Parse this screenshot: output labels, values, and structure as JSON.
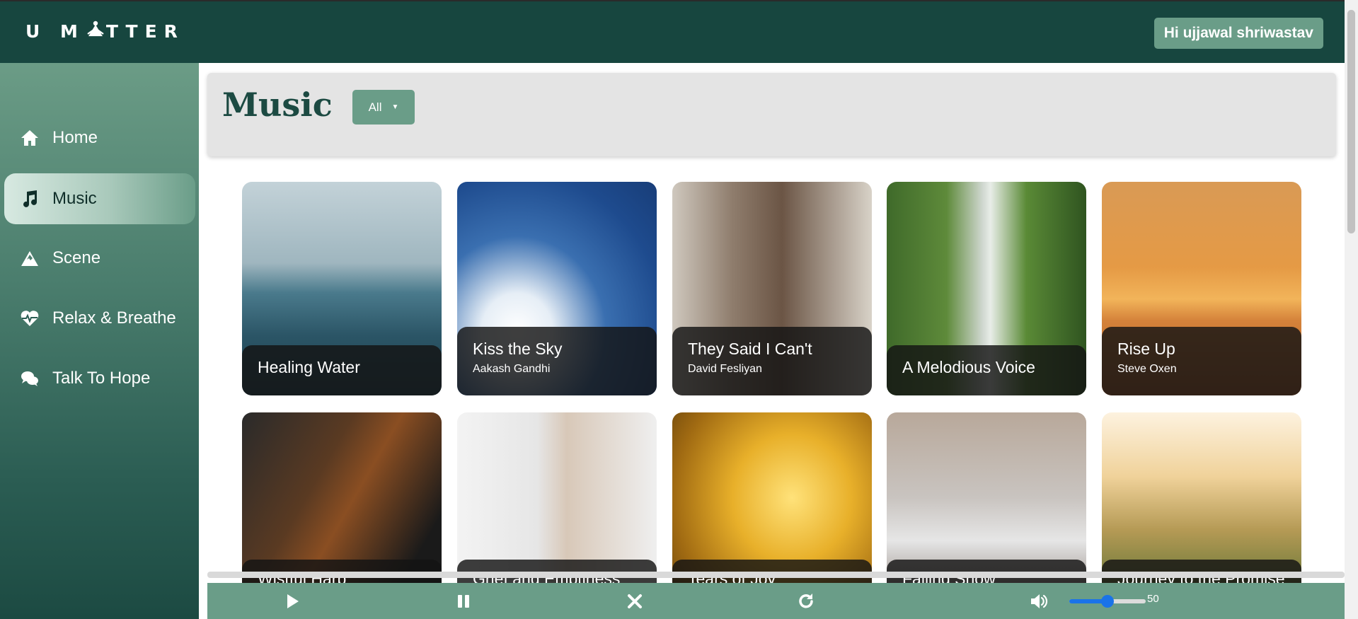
{
  "header": {
    "logo_left": "U M",
    "logo_right": "TTER",
    "greeting": "Hi ujjawal shriwastav"
  },
  "sidebar": {
    "items": [
      {
        "label": "Home",
        "icon": "home-icon",
        "active": false
      },
      {
        "label": "Music",
        "icon": "music-note-icon",
        "active": true
      },
      {
        "label": "Scene",
        "icon": "mountain-icon",
        "active": false
      },
      {
        "label": "Relax & Breathe",
        "icon": "heartbeat-icon",
        "active": false
      },
      {
        "label": "Talk To Hope",
        "icon": "chat-bubbles-icon",
        "active": false
      }
    ]
  },
  "main": {
    "title": "Music",
    "filter": {
      "selected": "All"
    },
    "cards": [
      {
        "title": "Healing Water",
        "artist": ""
      },
      {
        "title": "Kiss the Sky",
        "artist": "Aakash Gandhi"
      },
      {
        "title": "They Said I Can't",
        "artist": "David Fesliyan"
      },
      {
        "title": "A Melodious Voice",
        "artist": ""
      },
      {
        "title": "Rise Up",
        "artist": "Steve Oxen"
      },
      {
        "title": "Wistful Harp",
        "artist": ""
      },
      {
        "title": "Grief and Emptiness",
        "artist": ""
      },
      {
        "title": "Tears of Joy",
        "artist": ""
      },
      {
        "title": "Falling Snow",
        "artist": ""
      },
      {
        "title": "Journey to the Promise",
        "artist": ""
      }
    ]
  },
  "player": {
    "volume": "50",
    "volume_fraction": 0.5,
    "controls": [
      "play-icon",
      "pause-icon",
      "close-icon",
      "replay-icon"
    ]
  },
  "colors": {
    "header_bg": "#17463f",
    "accent": "#6a9d88",
    "title_color": "#1c4a42"
  }
}
